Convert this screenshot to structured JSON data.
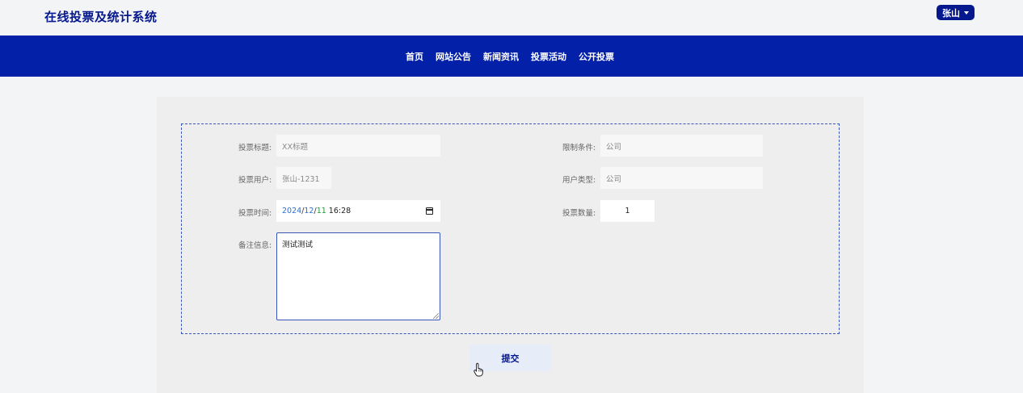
{
  "header": {
    "title": "在线投票及统计系统",
    "user_menu": "张山"
  },
  "nav": {
    "items": [
      {
        "label": "首页"
      },
      {
        "label": "网站公告"
      },
      {
        "label": "新闻资讯"
      },
      {
        "label": "投票活动"
      },
      {
        "label": "公开投票"
      }
    ]
  },
  "form": {
    "vote_title": {
      "label": "投票标题:",
      "value": "XX标题"
    },
    "limit_condition": {
      "label": "限制条件:",
      "value": "公司"
    },
    "vote_user": {
      "label": "投票用户:",
      "value": "张山-1231"
    },
    "user_type": {
      "label": "用户类型:",
      "value": "公司"
    },
    "vote_time": {
      "label": "投票时间:",
      "year": "2024",
      "month": "12",
      "day": "11",
      "time": "16:28"
    },
    "vote_count": {
      "label": "投票数量:",
      "value": "1"
    },
    "remark": {
      "label": "备注信息:",
      "value": "测试测试"
    },
    "submit_label": "提交"
  },
  "icons": {
    "calendar": "calendar-icon",
    "dropdown": "chevron-down-icon",
    "cursor": "hand-pointer-icon"
  },
  "colors": {
    "brand": "#06188e",
    "nav_bg": "#0320a8",
    "panel_bg": "#eeeeee",
    "page_bg": "#f3f4f6"
  }
}
